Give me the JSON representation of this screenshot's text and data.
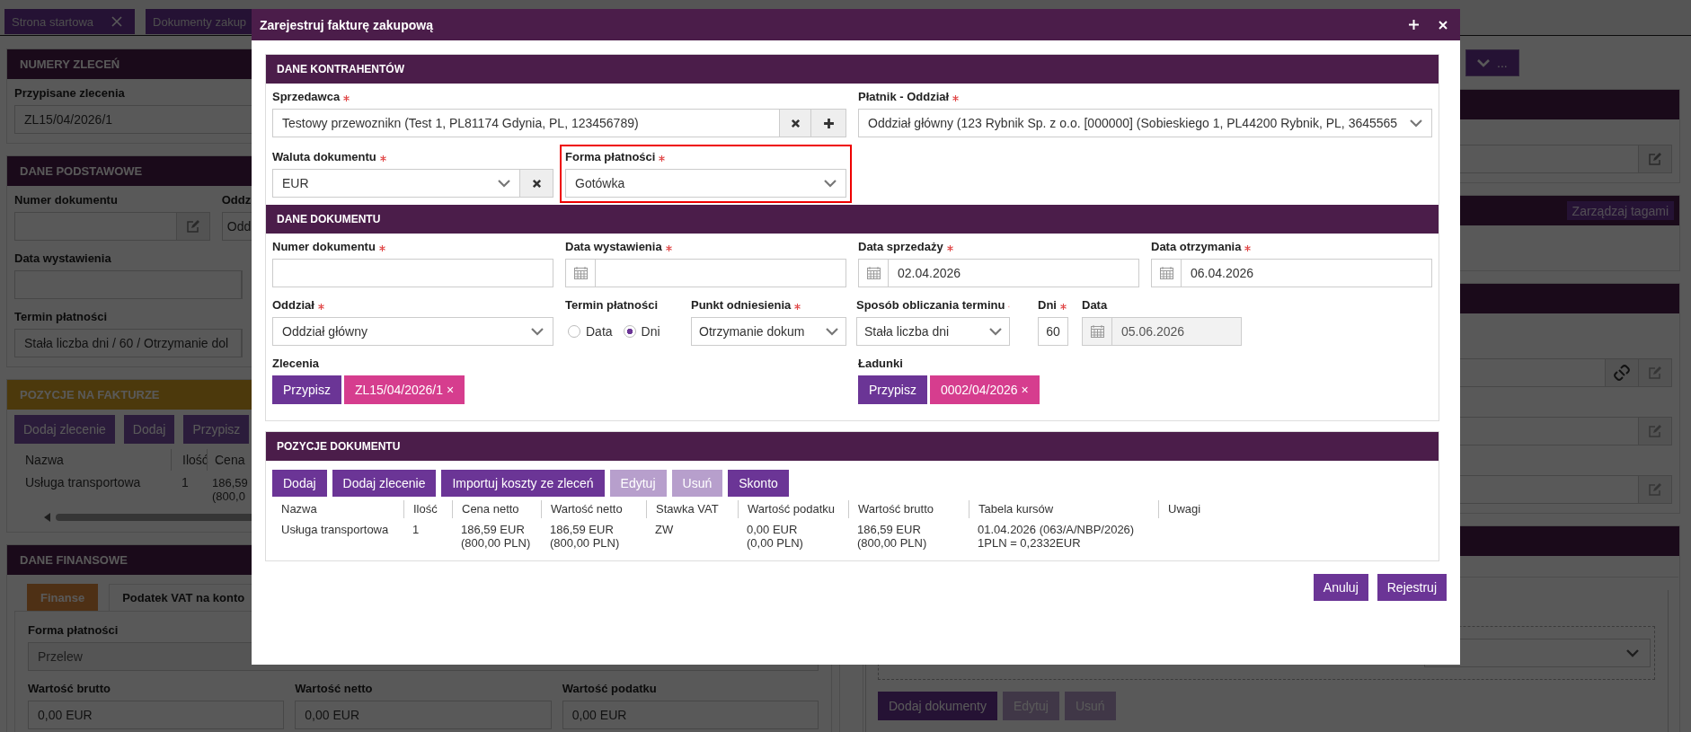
{
  "tabs": [
    {
      "label": "Strona startowa",
      "closable": true
    },
    {
      "label": "Dokumenty zakup"
    }
  ],
  "left": {
    "orders": {
      "header": "NUMERY ZLECEŃ",
      "label": "Przypisane zlecenia",
      "value": "ZL15/04/2026/1"
    },
    "basic": {
      "header": "DANE PODSTAWOWE",
      "number_label": "Numer dokumentu",
      "branch_label": "Oddz",
      "branch_value": "Odd",
      "issue_label": "Data wystawienia",
      "term_label": "Termin płatności",
      "term_value": "Stała liczba dni / 60 / Otrzymanie dol"
    },
    "items": {
      "header": "POZYCJE NA FAKTURZE",
      "buttons": [
        "Dodaj zlecenie",
        "Dodaj",
        "Przypisz"
      ],
      "columns": [
        "Nazwa",
        "Ilość",
        "Cena"
      ],
      "rows": [
        [
          "Usługa transportowa",
          "1",
          "186,59\n(800,0"
        ]
      ]
    },
    "finance": {
      "header": "DANE FINANSOWE",
      "tabs": [
        {
          "label": "Finanse",
          "selected": true
        },
        {
          "label": "Podatek VAT na konto",
          "selected": false
        }
      ],
      "payment_label": "Forma płatności",
      "payment_value": "Przelew",
      "totals": [
        {
          "label": "Wartość brutto",
          "value": "0,00 EUR"
        },
        {
          "label": "Wartość netto",
          "value": "0,00 EUR"
        },
        {
          "label": "Wartość podatku",
          "value": "0,00 EUR"
        }
      ]
    }
  },
  "right": {
    "more_button": "...",
    "tags_button": "Zarządzaj tagami",
    "buttons": [
      {
        "label": "Dodaj dokumenty",
        "disabled": false
      },
      {
        "label": "Edytuj",
        "disabled": true
      },
      {
        "label": "Usuń",
        "disabled": true
      }
    ]
  },
  "dialog": {
    "title": "Zarejestruj fakturę zakupową",
    "contractors": {
      "header": "DANE KONTRAHENTÓW",
      "seller": {
        "label": "Sprzedawca",
        "required": true,
        "value": "Testowy przewoznikn (Test 1, PL81174 Gdynia, PL, 123456789)"
      },
      "payer": {
        "label": "Płatnik - Oddział",
        "required": true,
        "value": "Oddział główny (123 Rybnik Sp. z o.o. [000000] (Sobieskiego 1, PL44200 Rybnik, PL, 3645565"
      },
      "currency": {
        "label": "Waluta dokumentu",
        "required": true,
        "value": "EUR"
      },
      "payment_form": {
        "label": "Forma płatności",
        "required": true,
        "value": "Gotówka",
        "highlighted": true
      }
    },
    "document": {
      "header": "DANE DOKUMENTU",
      "number": {
        "label": "Numer dokumentu",
        "required": true
      },
      "issue_date": {
        "label": "Data wystawienia",
        "required": true
      },
      "sale_date": {
        "label": "Data sprzedaży",
        "required": true,
        "value": "02.04.2026"
      },
      "receipt_date": {
        "label": "Data otrzymania",
        "required": true,
        "value": "06.04.2026"
      },
      "branch": {
        "label": "Oddział",
        "required": true,
        "value": "Oddział główny"
      },
      "payment_term": {
        "label": "Termin płatności",
        "options": [
          {
            "label": "Data",
            "selected": false
          },
          {
            "label": "Dni",
            "selected": true
          }
        ]
      },
      "reference": {
        "label": "Punkt odniesienia",
        "required": true,
        "value": "Otrzymanie dokum"
      },
      "method": {
        "label": "Sposób obliczania terminu",
        "required": true,
        "value": "Stała liczba dni"
      },
      "days": {
        "label": "Dni",
        "required": true,
        "value": "60"
      },
      "due_date": {
        "label": "Data",
        "value": "05.06.2026"
      },
      "orders": {
        "label": "Zlecenia",
        "button": "Przypisz",
        "tags": [
          "ZL15/04/2026/1 ×"
        ]
      },
      "loads": {
        "label": "Ładunki",
        "button": "Przypisz",
        "tags": [
          "0002/04/2026 ×"
        ]
      }
    },
    "positions": {
      "header": "POZYCJE DOKUMENTU",
      "buttons": [
        {
          "label": "Dodaj",
          "disabled": false
        },
        {
          "label": "Dodaj zlecenie",
          "disabled": false
        },
        {
          "label": "Importuj koszty ze zleceń",
          "disabled": false
        },
        {
          "label": "Edytuj",
          "disabled": true
        },
        {
          "label": "Usuń",
          "disabled": true
        },
        {
          "label": "Skonto",
          "disabled": false
        }
      ],
      "columns": [
        "Nazwa",
        "Ilość",
        "Cena netto",
        "Wartość netto",
        "Stawka VAT",
        "Wartość podatku",
        "Wartość brutto",
        "Tabela kursów",
        "Uwagi"
      ],
      "rows": [
        [
          "Usługa transportowa",
          "1",
          "186,59 EUR\n(800,00 PLN)",
          "186,59 EUR\n(800,00 PLN)",
          "ZW",
          "0,00 EUR\n(0,00 PLN)",
          "186,59 EUR\n(800,00 PLN)",
          "01.04.2026 (063/A/NBP/2026)\n1PLN = 0,2332EUR"
        ]
      ]
    },
    "footer_buttons": [
      "Anuluj",
      "Rejestruj"
    ]
  }
}
